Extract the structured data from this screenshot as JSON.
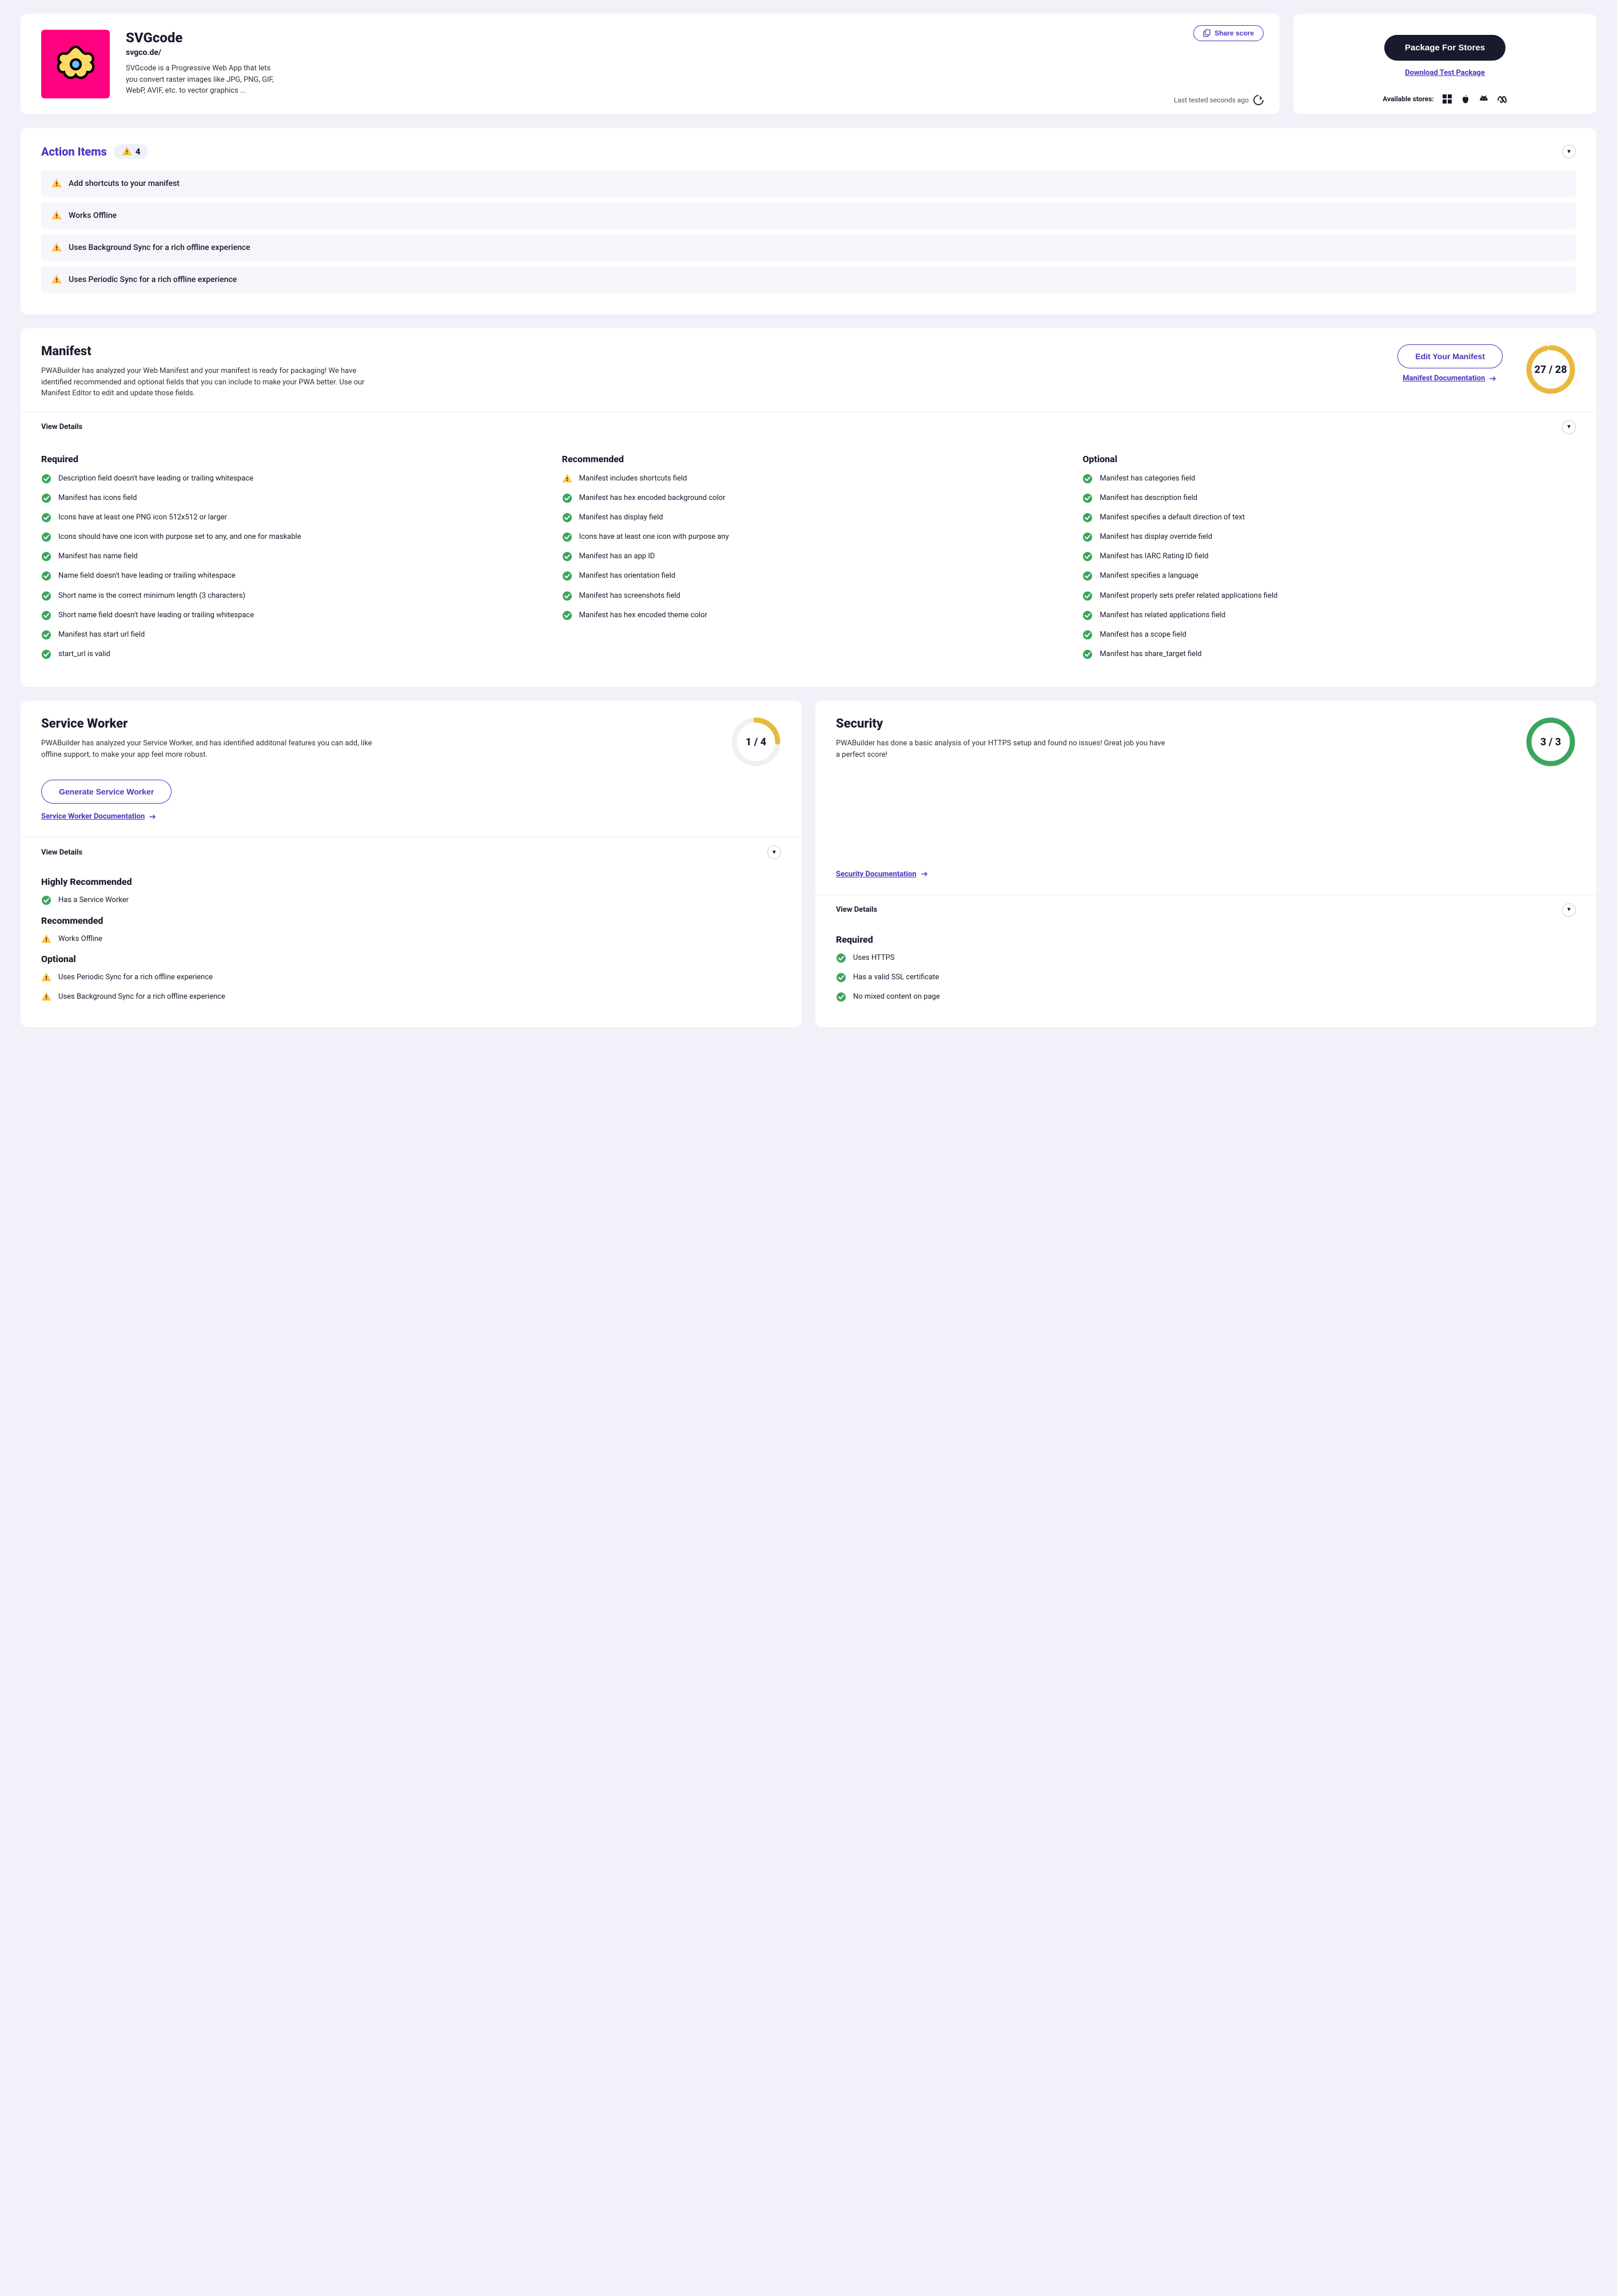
{
  "app": {
    "title": "SVGcode",
    "url": "svgco.de/",
    "description": "SVGcode is a Progressive Web App that lets you convert raster images like JPG, PNG, GIF, WebP, AVIF, etc. to vector graphics ...",
    "share_label": "Share score",
    "last_tested": "Last tested seconds ago"
  },
  "package": {
    "button": "Package For Stores",
    "download": "Download Test Package",
    "stores_label": "Available stores:"
  },
  "action": {
    "title": "Action Items",
    "count": "4",
    "items": [
      "Add shortcuts to your manifest",
      "Works Offline",
      "Uses Background Sync for a rich offline experience",
      "Uses Periodic Sync for a rich offline experience"
    ]
  },
  "manifest": {
    "title": "Manifest",
    "description": "PWABuilder has analyzed your Web Manifest and your manifest is ready for packaging! We have identified recommended and optional fields that you can include to make your PWA better. Use our Manifest Editor to edit and update those fields.",
    "edit_button": "Edit Your Manifest",
    "doc_link": "Manifest Documentation",
    "score": "27 / 28",
    "score_num": 27,
    "score_den": 28,
    "view_details": "View Details",
    "columns": {
      "required": {
        "title": "Required",
        "items": [
          "Description field doesn't have leading or trailing whitespace",
          "Manifest has icons field",
          "Icons have at least one PNG icon 512x512 or larger",
          "Icons should have one icon with purpose set to any, and one for maskable",
          "Manifest has name field",
          "Name field doesn't have leading or trailing whitespace",
          "Short name is the correct minimum length (3 characters)",
          "Short name field doesn't have leading or trailing whitespace",
          "Manifest has start url field",
          "start_url is valid"
        ]
      },
      "recommended": {
        "title": "Recommended",
        "items": [
          {
            "text": "Manifest includes shortcuts field",
            "status": "warn"
          },
          {
            "text": "Manifest has hex encoded background color",
            "status": "ok"
          },
          {
            "text": "Manifest has display field",
            "status": "ok"
          },
          {
            "text": "Icons have at least one icon with purpose any",
            "status": "ok"
          },
          {
            "text": "Manifest has an app ID",
            "status": "ok"
          },
          {
            "text": "Manifest has orientation field",
            "status": "ok"
          },
          {
            "text": "Manifest has screenshots field",
            "status": "ok"
          },
          {
            "text": "Manifest has hex encoded theme color",
            "status": "ok"
          }
        ]
      },
      "optional": {
        "title": "Optional",
        "items": [
          "Manifest has categories field",
          "Manifest has description field",
          "Manifest specifies a default direction of text",
          "Manifest has display override field",
          "Manifest has IARC Rating ID field",
          "Manifest specifies a language",
          "Manifest properly sets prefer related applications field",
          "Manifest has related applications field",
          "Manifest has a scope field",
          "Manifest has share_target field"
        ]
      }
    }
  },
  "sw": {
    "title": "Service Worker",
    "description": "PWABuilder has analyzed your Service Worker, and has identified additonal features you can add, like offline support, to make your app feel more robust.",
    "score": "1 / 4",
    "score_num": 1,
    "score_den": 4,
    "generate_button": "Generate Service Worker",
    "doc_link": "Service Worker Documentation",
    "view_details": "View Details",
    "sections": [
      {
        "title": "Highly Recommended",
        "items": [
          {
            "text": "Has a Service Worker",
            "status": "ok"
          }
        ]
      },
      {
        "title": "Recommended",
        "items": [
          {
            "text": "Works Offline",
            "status": "warn"
          }
        ]
      },
      {
        "title": "Optional",
        "items": [
          {
            "text": "Uses Periodic Sync for a rich offline experience",
            "status": "warn"
          },
          {
            "text": "Uses Background Sync for a rich offline experience",
            "status": "warn"
          }
        ]
      }
    ]
  },
  "security": {
    "title": "Security",
    "description": "PWABuilder has done a basic analysis of your HTTPS setup and found no issues! Great job you have a perfect score!",
    "score": "3 / 3",
    "score_num": 3,
    "score_den": 3,
    "doc_link": "Security Documentation",
    "view_details": "View Details",
    "sections": [
      {
        "title": "Required",
        "items": [
          {
            "text": "Uses HTTPS",
            "status": "ok"
          },
          {
            "text": "Has a valid SSL certificate",
            "status": "ok"
          },
          {
            "text": "No mixed content on page",
            "status": "ok"
          }
        ]
      }
    ]
  }
}
